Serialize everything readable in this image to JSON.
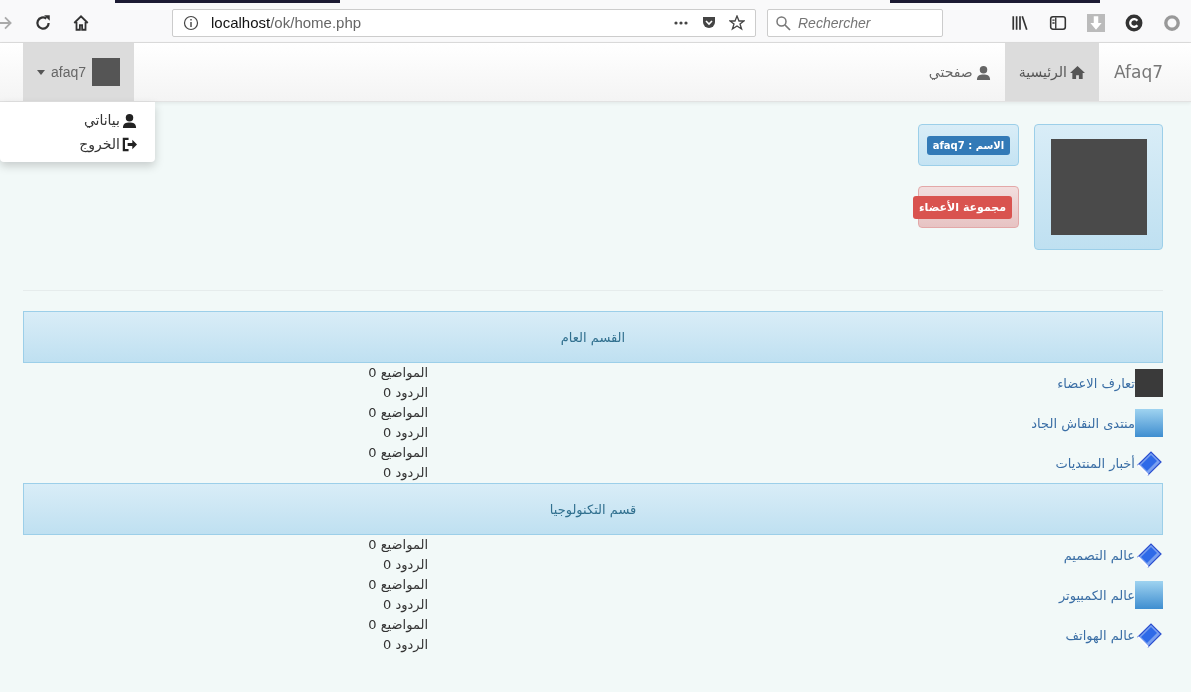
{
  "browser": {
    "url_host": "localhost",
    "url_path": "/ok/home.php",
    "search_placeholder": "Rechercher"
  },
  "navbar": {
    "brand": "Afaq7",
    "items": [
      {
        "label": "الرئيسية",
        "kind": "home",
        "selected": true
      },
      {
        "label": "صفحتي",
        "kind": "user",
        "selected": false
      }
    ],
    "user_menu": {
      "name": "afaq7",
      "expanded": true,
      "items": [
        {
          "label": "بياناتي",
          "kind": "user"
        },
        {
          "label": "الخروج",
          "kind": "logout"
        }
      ]
    }
  },
  "profile": {
    "name_badge": "الاسم : afaq7",
    "group_badge": "مجموعة الأعضاء"
  },
  "sections": [
    {
      "title": "القسم العام",
      "forums": [
        {
          "name": "تعارف الاعضاء",
          "kind": "photo",
          "topics": "المواضيع 0",
          "replies": "الردود 0"
        },
        {
          "name": "منتدى النقاش الجاد",
          "kind": "image",
          "topics": "المواضيع 0",
          "replies": "الردود 0"
        },
        {
          "name": "أخبار المنتديات",
          "kind": "book",
          "topics": "المواضيع 0",
          "replies": "الردود 0"
        }
      ]
    },
    {
      "title": "قسم التكنولوجيا",
      "forums": [
        {
          "name": "عالم التصميم",
          "kind": "book",
          "topics": "المواضيع 0",
          "replies": "الردود 0"
        },
        {
          "name": "عالم الكمبيوتر",
          "kind": "image",
          "topics": "المواضيع 0",
          "replies": "الردود 0"
        },
        {
          "name": "عالم الهواتف",
          "kind": "book",
          "topics": "المواضيع 0",
          "replies": "الردود 0"
        }
      ]
    }
  ]
}
